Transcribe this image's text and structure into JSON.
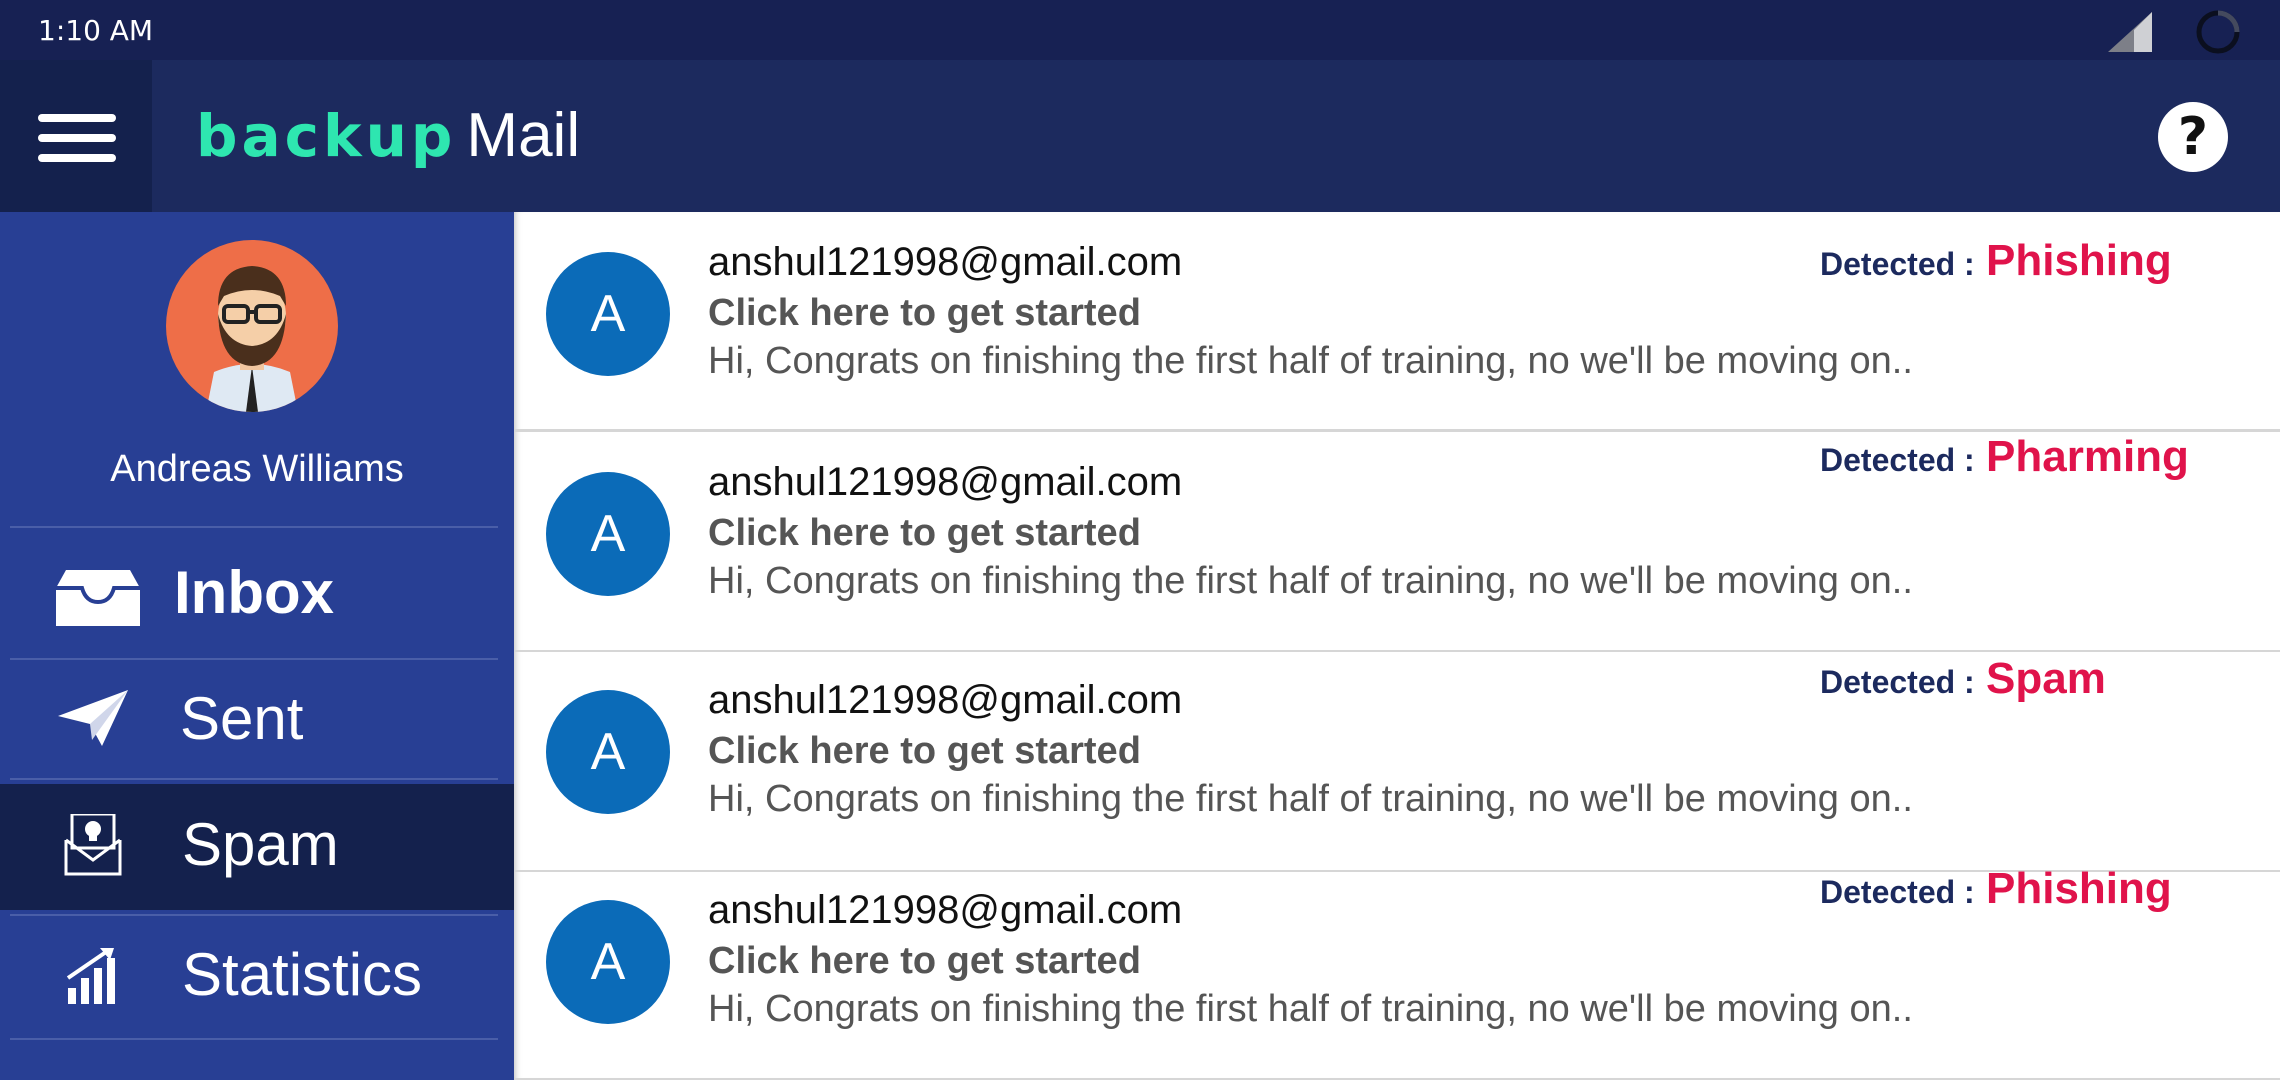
{
  "status_bar": {
    "time": "1:10 AM"
  },
  "app_bar": {
    "logo_prefix": "backup",
    "logo_suffix": "Mail",
    "help_label": "?"
  },
  "user": {
    "name": "Andreas Williams"
  },
  "nav": [
    {
      "label": "Inbox",
      "icon": "inbox-icon",
      "active": false
    },
    {
      "label": "Sent",
      "icon": "send-icon",
      "active": false
    },
    {
      "label": "Spam",
      "icon": "spam-icon",
      "active": true
    },
    {
      "label": "Statistics",
      "icon": "statistics-icon",
      "active": false
    }
  ],
  "mails": [
    {
      "avatar": "A",
      "from": "anshul121998@gmail.com",
      "subject": "Click here to get started",
      "preview": "Hi, Congrats on finishing the first half of training, no we'll be moving on..",
      "detected_label": "Detected :",
      "detected_value": "Phishing"
    },
    {
      "avatar": "A",
      "from": "anshul121998@gmail.com",
      "subject": "Click here to get started",
      "preview": "Hi, Congrats on finishing the first half of training, no we'll be moving on..",
      "detected_label": "Detected :",
      "detected_value": "Pharming"
    },
    {
      "avatar": "A",
      "from": "anshul121998@gmail.com",
      "subject": "Click here to get started",
      "preview": "Hi, Congrats on finishing the first half of training, no we'll be moving on..",
      "detected_label": "Detected :",
      "detected_value": "Spam"
    },
    {
      "avatar": "A",
      "from": "anshul121998@gmail.com",
      "subject": "Click here to get started",
      "preview": "Hi, Congrats on finishing the first half of training, no we'll be moving on..",
      "detected_label": "Detected :",
      "detected_value": "Phishing"
    }
  ],
  "colors": {
    "status_bar": "#172153",
    "app_bar": "#1c2a5e",
    "sidebar": "#283f94",
    "active_nav": "#14214d",
    "logo_accent": "#2ee6b0",
    "avatar_blue": "#0b6bb8",
    "detected_red": "#e0134b"
  }
}
